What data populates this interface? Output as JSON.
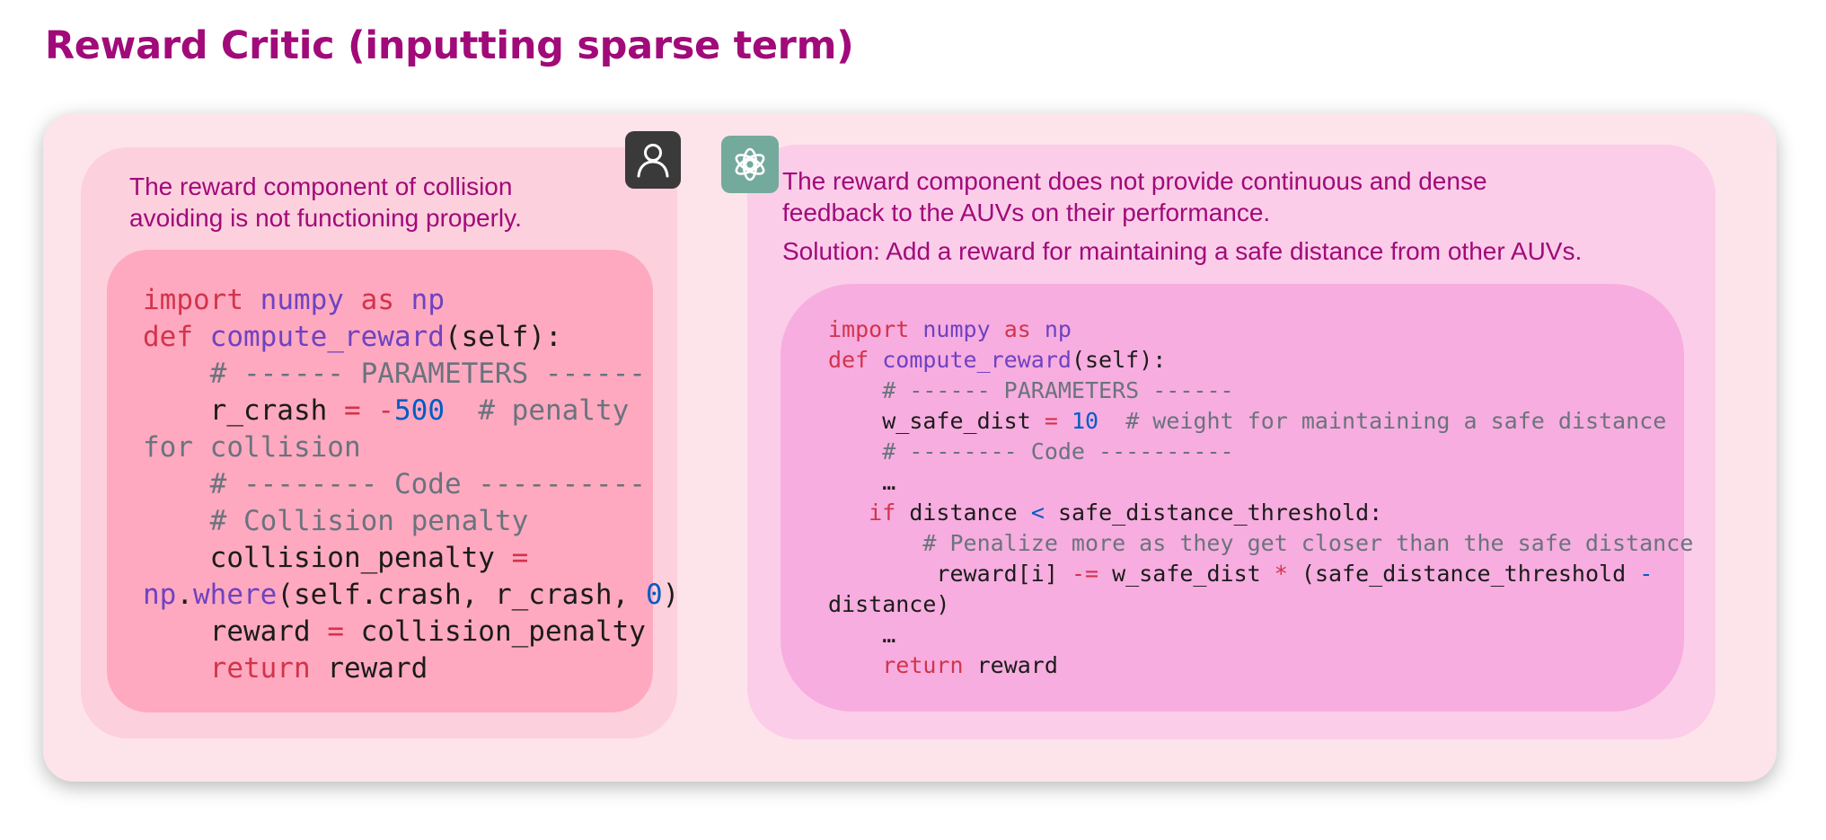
{
  "title": "Reward Critic (inputting sparse term)",
  "icons": {
    "user": "user-avatar-icon",
    "assistant": "openai-logo-icon"
  },
  "colors": {
    "title": "#a10a79",
    "outer_bg": "#fde4ea",
    "user_panel": "#fdd0dd",
    "user_code_bg": "#fea9c0",
    "ai_panel": "#fbcde9",
    "ai_code_bg": "#f7addf",
    "user_avatar": "#3a3a3a",
    "ai_avatar": "#74aa9c"
  },
  "user": {
    "message_line1": "The reward component of collision",
    "message_line2": "avoiding is not functioning properly.",
    "code": {
      "import": "import",
      "numpy": "numpy",
      "as": "as",
      "np": "np",
      "def": "def",
      "fn_name": "compute_reward",
      "params": "(self):",
      "param_comment": "# ------ PARAMETERS ------",
      "r_crash_var": "r_crash",
      "eq": "=",
      "minus": "-",
      "r_crash_val": "500",
      "r_crash_comment_a": "# penalty",
      "r_crash_comment_b": "for collision",
      "code_comment": "# -------- Code ----------",
      "collision_comment": "# Collision penalty",
      "collision_var": "collision_penalty",
      "np2": "np",
      "dot": ".",
      "where": "where",
      "where_args": "(self.crash, r_crash, ",
      "zero": "0",
      "close": ")",
      "reward_var": "reward",
      "collision_ref": "collision_penalty",
      "return": "return",
      "reward_ret": "reward"
    }
  },
  "assistant": {
    "message_line1": "The reward component does not provide continuous and dense",
    "message_line2": "feedback to the AUVs on their performance.",
    "solution": "Solution: Add a reward for maintaining a safe distance from other AUVs.",
    "code": {
      "import": "import",
      "numpy": "numpy",
      "as": "as",
      "np": "np",
      "def": "def",
      "fn_name": "compute_reward",
      "params": "(self):",
      "param_comment": "# ------ PARAMETERS ------",
      "w_var": "w_safe_dist",
      "eq": "=",
      "w_val": "10",
      "w_comment": "# weight for maintaining a safe distance",
      "code_comment": "# -------- Code ----------",
      "ellipsis1": "…",
      "if": "if",
      "distance": "distance",
      "lt": "<",
      "threshold": "safe_distance_threshold:",
      "penalize_comment": "# Penalize more as they get closer than the safe distance",
      "reward_idx": "reward[i]",
      "minus_eq": "-=",
      "w_ref": "w_safe_dist",
      "mult": "*",
      "paren_open": "(safe_distance_threshold",
      "minus": "-",
      "distance_close": "distance)",
      "ellipsis2": "…",
      "return": "return",
      "reward_ret": "reward"
    }
  }
}
